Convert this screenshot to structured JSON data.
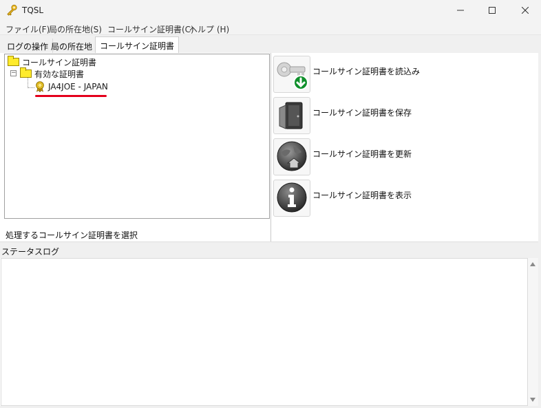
{
  "window": {
    "title": "TQSL",
    "app_icon": "key-icon",
    "controls": [
      "minimize-icon",
      "maximize-icon",
      "close-icon"
    ]
  },
  "menu": {
    "items": [
      "ファイル(F)",
      "局の所在地(S)",
      "コールサイン証明書(C)",
      "ヘルプ (H)"
    ]
  },
  "tabs": {
    "items": [
      "ログの操作",
      "局の所在地",
      "コールサイン証明書"
    ],
    "active_index": 2
  },
  "tree": {
    "root_label": "コールサイン証明書",
    "group_label": "有効な証明書",
    "expander_symbol": "−",
    "certificate_label": "JA4JOE - JAPAN",
    "certificate_icon": "certificate-medal-icon",
    "highlight_color": "#e4001b"
  },
  "left_status": "処理するコールサイン証明書を選択",
  "actions": [
    {
      "label": "コールサイン証明書を読込み",
      "icon": "key-download-icon"
    },
    {
      "label": "コールサイン証明書を保存",
      "icon": "save-door-icon"
    },
    {
      "label": "コールサイン証明書を更新",
      "icon": "globe-home-icon"
    },
    {
      "label": "コールサイン証明書を表示",
      "icon": "info-icon"
    }
  ],
  "status_log": {
    "label": "ステータスログ",
    "content": ""
  }
}
